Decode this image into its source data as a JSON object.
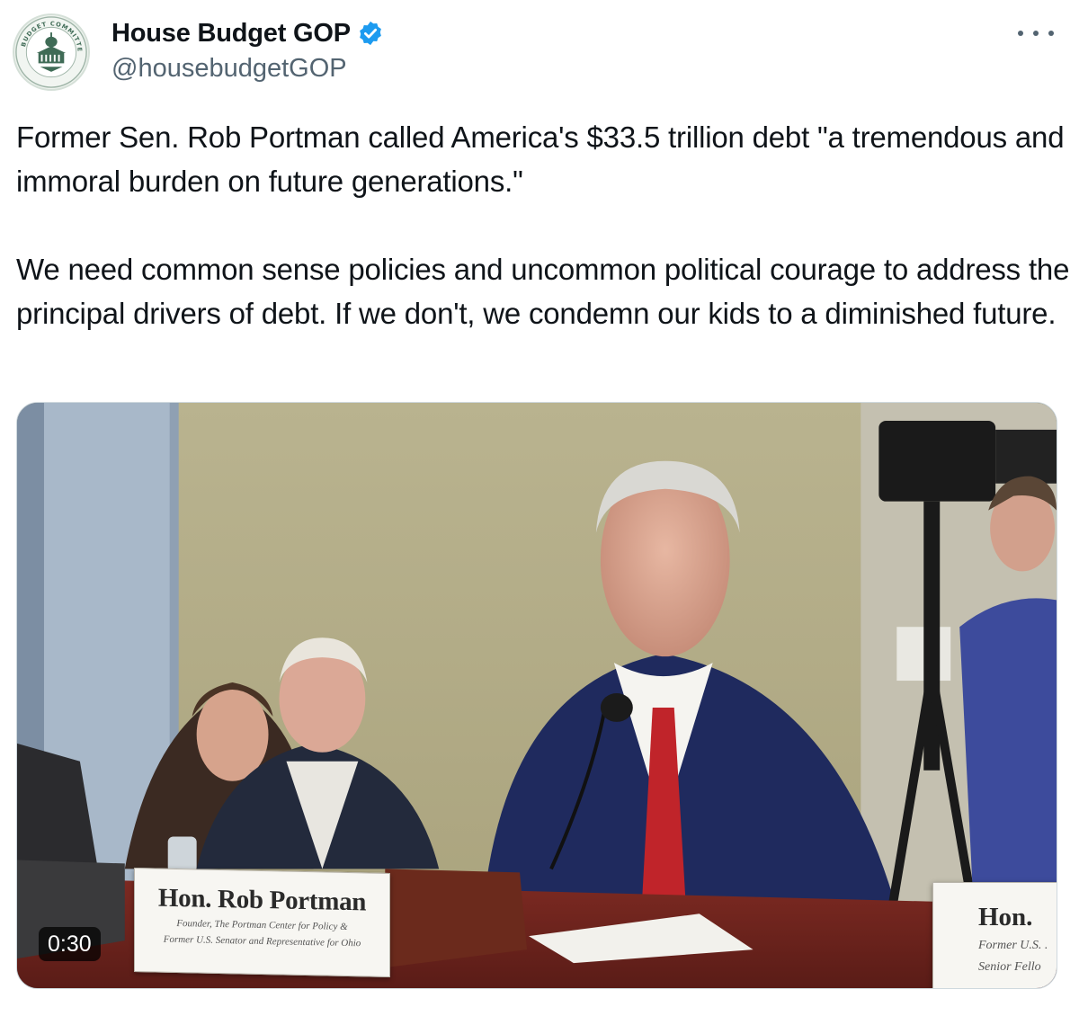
{
  "author": {
    "display_name": "House Budget GOP",
    "handle": "@housebudgetGOP",
    "avatar_icon": "budget-committee-seal-icon",
    "avatar_seal_text": "BUDGET COMMITTEE",
    "verified_color": "#1d9bf0"
  },
  "menu": {
    "icon": "more-horizontal-icon"
  },
  "post": {
    "paragraphs": [
      "Former Sen. Rob Portman called America's $33.5 trillion debt \"a tremendous and immoral burden on future generations.\"",
      "We need common sense policies and uncommon political courage to address the principal drivers of debt. If we don't, we condemn our kids to a diminished future."
    ]
  },
  "video": {
    "duration": "0:30",
    "nameplate_main": {
      "name": "Hon. Rob Portman",
      "line1": "Founder, The Portman Center for Policy &",
      "line2": "Former U.S. Senator and Representative for Ohio"
    },
    "nameplate_right": {
      "name": "Hon.",
      "line1": "Former U.S. .",
      "line2": "Senior Fello"
    }
  }
}
